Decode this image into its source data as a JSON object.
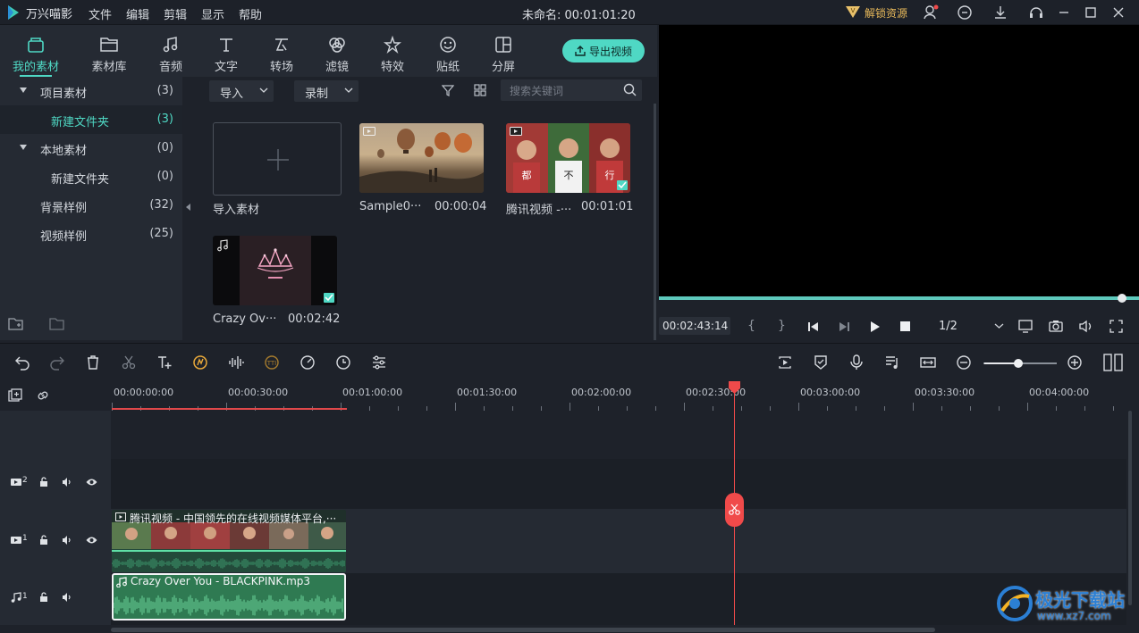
{
  "app": {
    "title": "万兴喵影",
    "project_title": "未命名: 00:01:01:20",
    "unlock_label": "解锁资源"
  },
  "menu": [
    "文件",
    "编辑",
    "剪辑",
    "显示",
    "帮助"
  ],
  "tabs": [
    {
      "label": "我的素材",
      "icon": "folder-open-icon"
    },
    {
      "label": "素材库",
      "icon": "folder-icon"
    },
    {
      "label": "音频",
      "icon": "music-note-icon"
    },
    {
      "label": "文字",
      "icon": "text-icon"
    },
    {
      "label": "转场",
      "icon": "transition-icon"
    },
    {
      "label": "滤镜",
      "icon": "filter-icon"
    },
    {
      "label": "特效",
      "icon": "effects-icon"
    },
    {
      "label": "贴纸",
      "icon": "sticker-icon"
    },
    {
      "label": "分屏",
      "icon": "split-screen-icon"
    }
  ],
  "export_label": "导出视频",
  "tree": [
    {
      "name": "项目素材",
      "count": "(3)",
      "expanded": true
    },
    {
      "name": "新建文件夹",
      "count": "(3)",
      "selected": true
    },
    {
      "name": "本地素材",
      "count": "(0)",
      "expanded": true
    },
    {
      "name": "新建文件夹",
      "count": "(0)"
    },
    {
      "name": "背景样例",
      "count": "(32)"
    },
    {
      "name": "视频样例",
      "count": "(25)"
    }
  ],
  "media": {
    "import_dropdown": "导入",
    "record_dropdown": "录制",
    "search_placeholder": "搜索关键词",
    "import_tile_label": "导入素材",
    "items": [
      {
        "name": "Sample0···",
        "duration": "00:00:04"
      },
      {
        "name": "腾讯视频 -···",
        "duration": "00:01:01"
      },
      {
        "name": "Crazy Ov···",
        "duration": "00:02:42"
      }
    ]
  },
  "preview": {
    "timecode": "00:02:43:14",
    "quality": "1/2",
    "progress": 0.965
  },
  "ruler": [
    "00:00:00:00",
    "00:00:30:00",
    "00:01:00:00",
    "00:01:30:00",
    "00:02:00:00",
    "00:02:30:00",
    "00:03:00:00",
    "00:03:30:00",
    "00:04:00:00"
  ],
  "tracks": {
    "video2_label": "2",
    "video1_label": "1",
    "audio1_label": "1",
    "video_clip_title": "腾讯视频 - 中国领先的在线视频媒体平台,···",
    "audio_clip_title": "Crazy Over You - BLACKPINK.mp3"
  },
  "watermark": {
    "brand": "极光下载站",
    "url": "www.xz7.com"
  },
  "colors": {
    "accent": "#4fd8c4",
    "playhead": "#f04a4a",
    "audio_clip": "#3d8f5e"
  }
}
